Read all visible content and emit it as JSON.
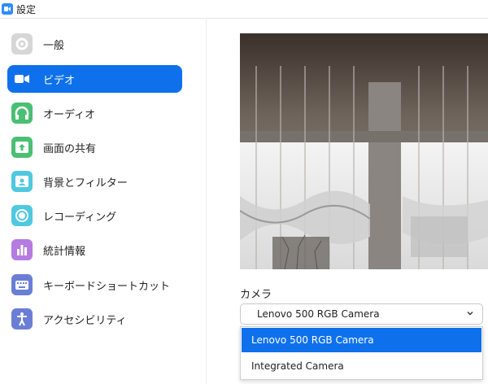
{
  "window": {
    "title": "設定"
  },
  "sidebar": {
    "items": [
      {
        "label": "一般",
        "icon": "gear-icon",
        "active": false
      },
      {
        "label": "ビデオ",
        "icon": "video-camera-icon",
        "active": true
      },
      {
        "label": "オーディオ",
        "icon": "headphones-icon",
        "active": false
      },
      {
        "label": "画面の共有",
        "icon": "share-screen-icon",
        "active": false
      },
      {
        "label": "背景とフィルター",
        "icon": "background-person-icon",
        "active": false
      },
      {
        "label": "レコーディング",
        "icon": "record-icon",
        "active": false
      },
      {
        "label": "統計情報",
        "icon": "bar-chart-icon",
        "active": false
      },
      {
        "label": "キーボードショートカット",
        "icon": "keyboard-icon",
        "active": false
      },
      {
        "label": "アクセシビリティ",
        "icon": "accessibility-icon",
        "active": false
      }
    ]
  },
  "video": {
    "camera_label": "カメラ",
    "selected_camera": "Lenovo 500 RGB Camera",
    "options": [
      "Lenovo 500 RGB Camera",
      "Integrated Camera"
    ]
  },
  "colors": {
    "accent": "#0e71eb",
    "app_icon": "#2d8cff"
  }
}
